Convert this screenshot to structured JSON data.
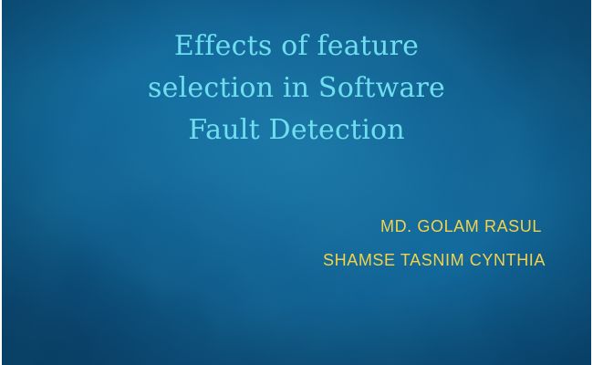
{
  "slide": {
    "title_lines": [
      "Effects of feature",
      "selection in Software",
      "Fault Detection"
    ],
    "authors": [
      "MD. GOLAM RASUL",
      "SHAMSE TASNIM CYNTHIA"
    ]
  },
  "colors": {
    "background": "#1577ad",
    "title": "#6fdff0",
    "authors": "#f3d24a"
  }
}
